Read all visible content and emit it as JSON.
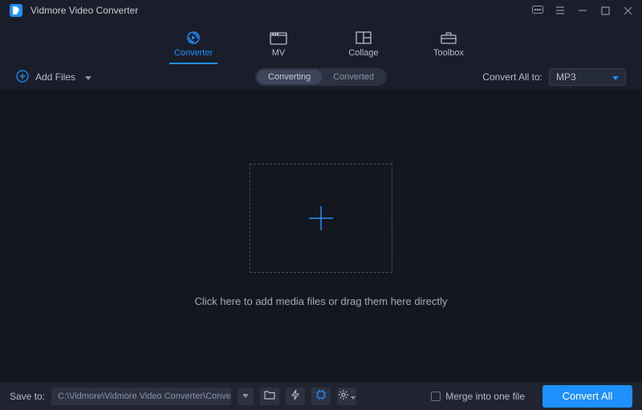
{
  "app": {
    "title": "Vidmore Video Converter"
  },
  "nav": {
    "items": [
      {
        "label": "Converter",
        "active": true
      },
      {
        "label": "MV",
        "active": false
      },
      {
        "label": "Collage",
        "active": false
      },
      {
        "label": "Toolbox",
        "active": false
      }
    ]
  },
  "actionbar": {
    "addfiles_label": "Add Files",
    "tab_converting": "Converting",
    "tab_converted": "Converted",
    "convert_all_to_label": "Convert All to:",
    "format_selected": "MP3"
  },
  "main": {
    "drop_hint": "Click here to add media files or drag them here directly"
  },
  "bottom": {
    "save_to_label": "Save to:",
    "save_path": "C:\\Vidmore\\Vidmore Video Converter\\Converted",
    "merge_label": "Merge into one file",
    "convert_button": "Convert All"
  },
  "colors": {
    "accent": "#1e90ff"
  }
}
